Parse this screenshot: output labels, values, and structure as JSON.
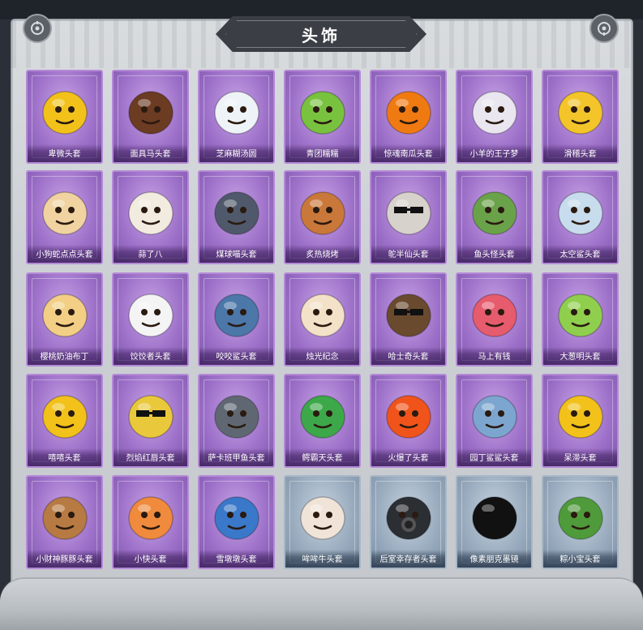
{
  "header": {
    "title": "头饰"
  },
  "colors": {
    "rare_frame": "#9c6fc8",
    "common_frame": "#98aabd",
    "panel": "#cdd1d5"
  },
  "items": [
    {
      "label": "卑微头套",
      "rarity": "purple",
      "icon": "worried-yellow-emoji-face",
      "color": "#f2c21b"
    },
    {
      "label": "面具马头套",
      "rarity": "purple",
      "icon": "horse-head-mask",
      "color": "#6b3b22"
    },
    {
      "label": "芝麻糊汤圆",
      "rarity": "purple",
      "icon": "rice-dumpling-face",
      "color": "#eef3f8"
    },
    {
      "label": "青团糯糯",
      "rarity": "purple",
      "icon": "green-rice-ball-face",
      "color": "#79c23f"
    },
    {
      "label": "惊魂南瓜头套",
      "rarity": "purple",
      "icon": "jack-o-lantern",
      "color": "#f07a12"
    },
    {
      "label": "小羊的王子梦",
      "rarity": "purple",
      "icon": "crowned-sheep",
      "color": "#e9e6f0"
    },
    {
      "label": "滑稽头套",
      "rarity": "purple",
      "icon": "funny-smirk-face",
      "color": "#f3c52a"
    },
    {
      "label": "小狗蛇点点头套",
      "rarity": "purple",
      "icon": "dog-snake-face",
      "color": "#f0d3a0"
    },
    {
      "label": "蒜了八",
      "rarity": "purple",
      "icon": "garlic-face",
      "color": "#f2ece0"
    },
    {
      "label": "煤球喵头套",
      "rarity": "purple",
      "icon": "gray-cat-face",
      "color": "#50596b"
    },
    {
      "label": "炙热烧烤",
      "rarity": "purple",
      "icon": "bbq-meat-face",
      "color": "#c9783a"
    },
    {
      "label": "鸵半仙头套",
      "rarity": "purple",
      "icon": "sunglasses-raccoon",
      "color": "#d8d2cc"
    },
    {
      "label": "鱼头怪头套",
      "rarity": "purple",
      "icon": "green-fish-head",
      "color": "#6aa24a"
    },
    {
      "label": "太空鲨头套",
      "rarity": "purple",
      "icon": "blue-shark-head",
      "color": "#c7dcec"
    },
    {
      "label": "樱桃奶油布丁",
      "rarity": "purple",
      "icon": "cherry-pudding-face",
      "color": "#f3cf85"
    },
    {
      "label": "饺饺者头套",
      "rarity": "purple",
      "icon": "dumpling-cloud-face",
      "color": "#f4f4f4"
    },
    {
      "label": "咬咬鲨头套",
      "rarity": "purple",
      "icon": "biting-shark",
      "color": "#4b77a9"
    },
    {
      "label": "烛光纪念",
      "rarity": "purple",
      "icon": "candle-face",
      "color": "#f3e1c8"
    },
    {
      "label": "哈士奇头套",
      "rarity": "purple",
      "icon": "husky-sunglasses",
      "color": "#6a4a2e"
    },
    {
      "label": "马上有钱",
      "rarity": "purple",
      "icon": "pink-horse-head",
      "color": "#e65b6d"
    },
    {
      "label": "大葱明头套",
      "rarity": "purple",
      "icon": "scallion-face",
      "color": "#8fcf4d"
    },
    {
      "label": "嘻嘻头套",
      "rarity": "purple",
      "icon": "grinning-emoji-face",
      "color": "#f2c21b"
    },
    {
      "label": "烈焰红唇头套",
      "rarity": "purple",
      "icon": "yellow-mouse-sunglasses",
      "color": "#e9c93b"
    },
    {
      "label": "萨卡班甲鱼头套",
      "rarity": "purple",
      "icon": "gray-fish-head",
      "color": "#5f6872"
    },
    {
      "label": "鳄霸天头套",
      "rarity": "purple",
      "icon": "crocodile-jaws",
      "color": "#3da84a"
    },
    {
      "label": "火爆了头套",
      "rarity": "purple",
      "icon": "fire-spirit-face",
      "color": "#f0541b"
    },
    {
      "label": "园丁鲨鲨头套",
      "rarity": "purple",
      "icon": "shark-with-antenna",
      "color": "#7ca6cf"
    },
    {
      "label": "呆滞头套",
      "rarity": "purple",
      "icon": "blank-stare-emoji",
      "color": "#f2c21b"
    },
    {
      "label": "小财神豚豚头套",
      "rarity": "purple",
      "icon": "capybara-fortune-god",
      "color": "#b77a43"
    },
    {
      "label": "小快头套",
      "rarity": "purple",
      "icon": "orange-tv-face",
      "color": "#f08a3c"
    },
    {
      "label": "雪墩墩头套",
      "rarity": "purple",
      "icon": "snowman-antlers",
      "color": "#3a78c9"
    },
    {
      "label": "哞哞牛头套",
      "rarity": "blue",
      "icon": "cow-head",
      "color": "#f0e4d8"
    },
    {
      "label": "后室幸存者头套",
      "rarity": "blue",
      "icon": "gas-mask-helmet",
      "color": "#2b2e33"
    },
    {
      "label": "像素朋克墨镜",
      "rarity": "blue",
      "icon": "pixel-sunglasses",
      "color": "#111111"
    },
    {
      "label": "粽小宝头套",
      "rarity": "blue",
      "icon": "rice-dumpling-leaf-face",
      "color": "#4f9a3a"
    }
  ]
}
